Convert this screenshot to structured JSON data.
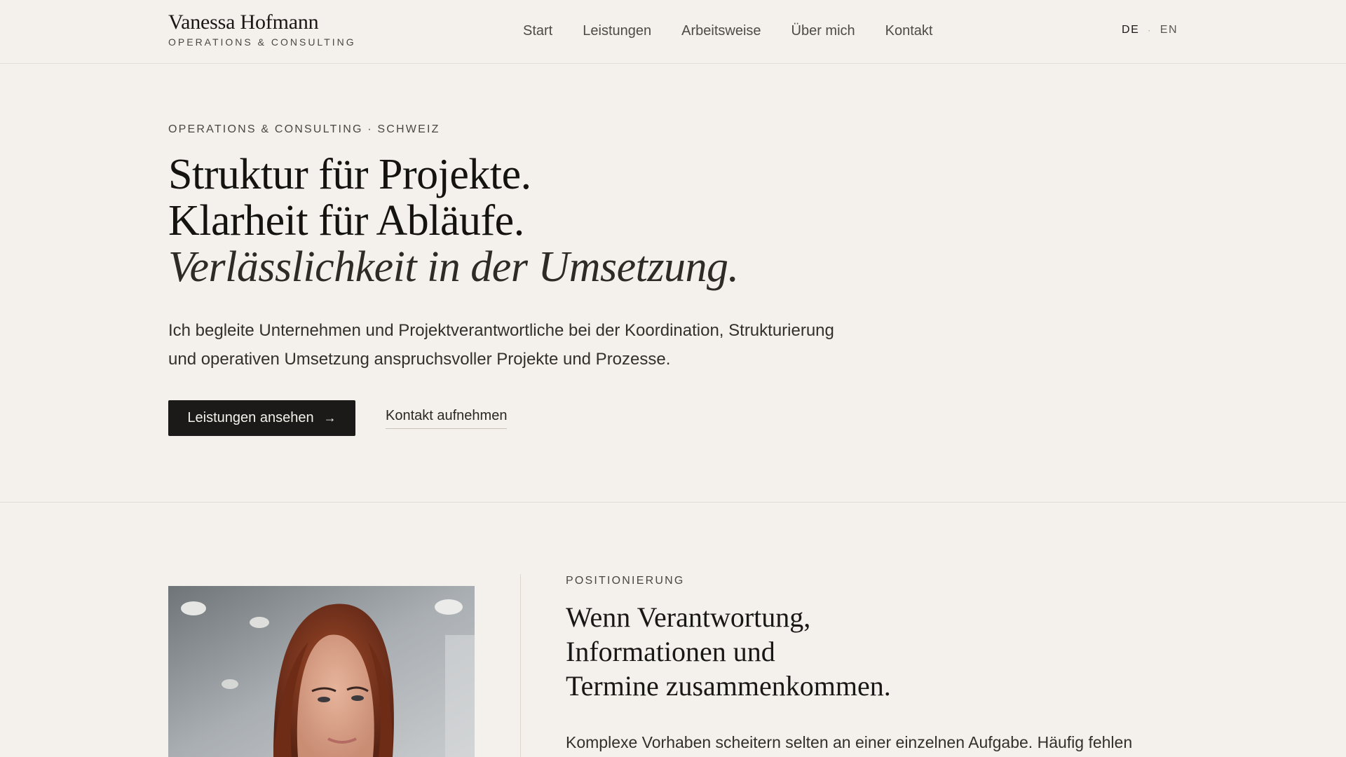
{
  "header": {
    "brand_name": "Vanessa Hofmann",
    "brand_tagline": "OPERATIONS & CONSULTING",
    "nav": [
      {
        "label": "Start"
      },
      {
        "label": "Leistungen"
      },
      {
        "label": "Arbeitsweise"
      },
      {
        "label": "Über mich"
      },
      {
        "label": "Kontakt"
      }
    ],
    "lang_active": "DE",
    "lang_separator": "·",
    "lang_inactive": "EN"
  },
  "hero": {
    "eyebrow": "OPERATIONS & CONSULTING · SCHWEIZ",
    "title_line1": "Struktur für Projekte.",
    "title_line2": "Klarheit für Abläufe.",
    "title_line3": "Verlässlichkeit in der Umsetzung.",
    "lead": "Ich begleite Unternehmen und Projektverantwortliche bei der Koordination, Strukturierung und operativen Umsetzung anspruchsvoller Projekte und Prozesse.",
    "primary_cta": "Leistungen ansehen",
    "primary_cta_arrow": "→",
    "secondary_cta": "Kontakt aufnehmen"
  },
  "positioning": {
    "eyebrow": "POSITIONIERUNG",
    "title_line1": "Wenn Verantwortung,",
    "title_line2": "Informationen und",
    "title_line3": "Termine zusammenkommen.",
    "body": "Komplexe Vorhaben scheitern selten an einer einzelnen Aufgabe. Häufig fehlen"
  },
  "colors": {
    "background": "#f4f1ec",
    "text": "#1c1a18",
    "button_bg": "#1c1a18",
    "button_text": "#f4f1ec",
    "hair": "#8a3a22"
  }
}
